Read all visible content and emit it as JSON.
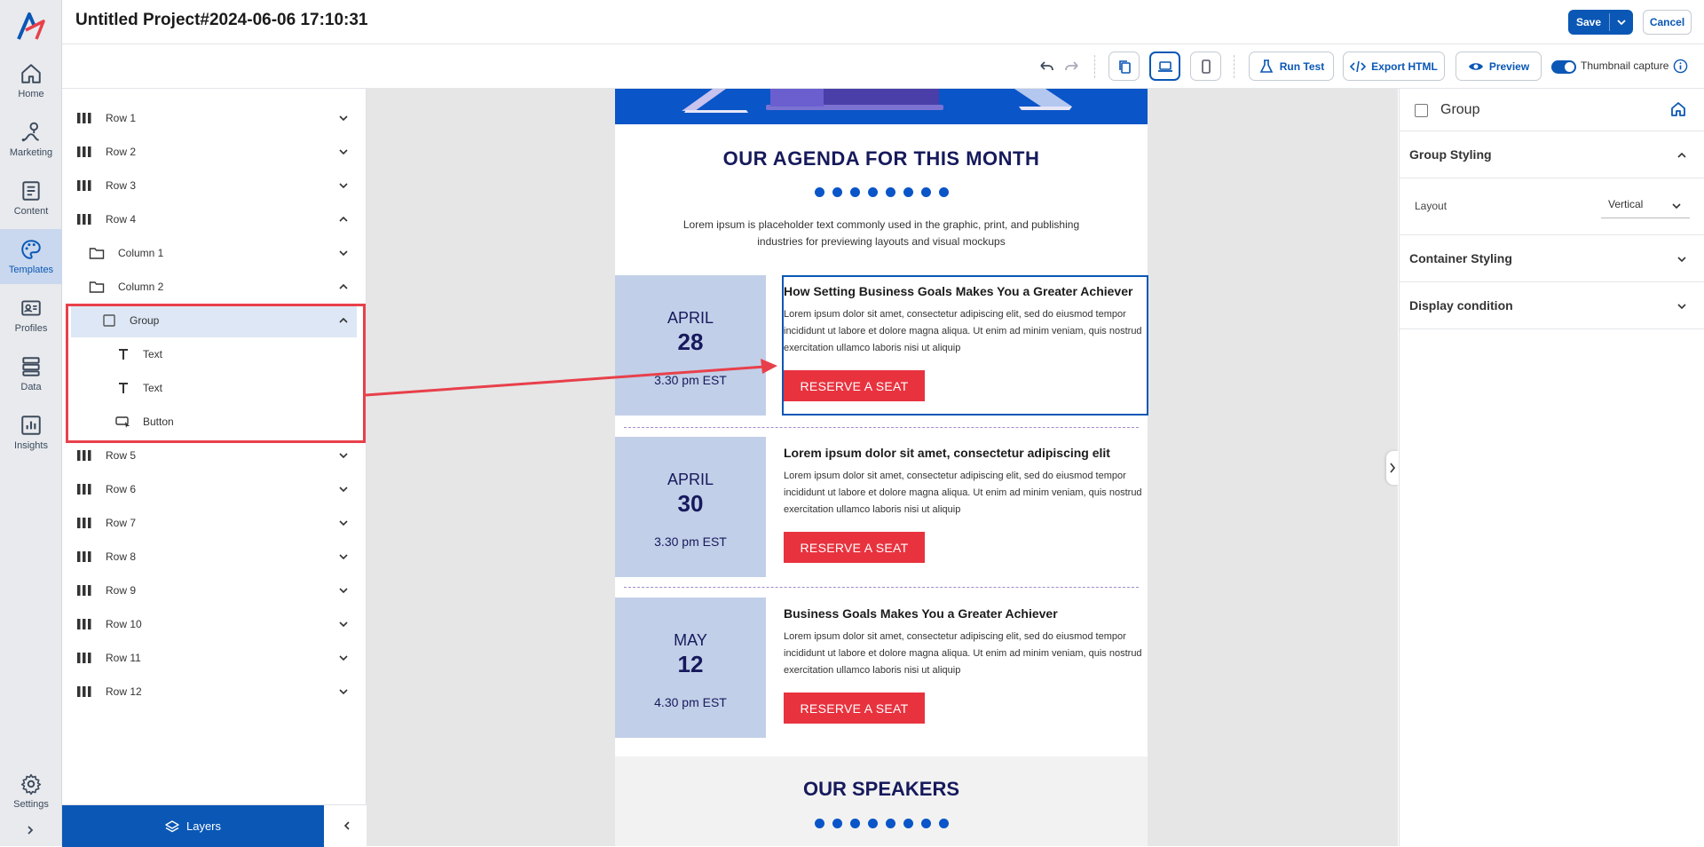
{
  "app": {
    "project_title": "Untitled Project#2024-06-06 17:10:31",
    "save_label": "Save",
    "cancel_label": "Cancel"
  },
  "nav": {
    "items": [
      {
        "label": "Home",
        "icon": "home-icon"
      },
      {
        "label": "Marketing",
        "icon": "marketing-icon"
      },
      {
        "label": "Content",
        "icon": "content-icon"
      },
      {
        "label": "Templates",
        "icon": "palette-icon",
        "active": true
      },
      {
        "label": "Profiles",
        "icon": "profiles-icon"
      },
      {
        "label": "Data",
        "icon": "database-icon"
      },
      {
        "label": "Insights",
        "icon": "chart-icon"
      }
    ],
    "settings_label": "Settings"
  },
  "toolbar": {
    "run_test": "Run Test",
    "export_html": "Export HTML",
    "preview": "Preview",
    "thumbnail_capture": "Thumbnail capture",
    "thumbnail_enabled": true,
    "active_device": "desktop"
  },
  "layers": {
    "items": [
      {
        "label": "Row 1",
        "type": "row",
        "expanded": false
      },
      {
        "label": "Row 2",
        "type": "row",
        "expanded": false
      },
      {
        "label": "Row 3",
        "type": "row",
        "expanded": false
      },
      {
        "label": "Row 4",
        "type": "row",
        "expanded": true
      },
      {
        "label": "Column 1",
        "type": "column",
        "expanded": false
      },
      {
        "label": "Column 2",
        "type": "column",
        "expanded": true
      },
      {
        "label": "Group",
        "type": "group",
        "expanded": true,
        "selected": true
      },
      {
        "label": "Text",
        "type": "text"
      },
      {
        "label": "Text",
        "type": "text"
      },
      {
        "label": "Button",
        "type": "button"
      },
      {
        "label": "Row 5",
        "type": "row",
        "expanded": false
      },
      {
        "label": "Row 6",
        "type": "row",
        "expanded": false
      },
      {
        "label": "Row 7",
        "type": "row",
        "expanded": false
      },
      {
        "label": "Row 8",
        "type": "row",
        "expanded": false
      },
      {
        "label": "Row 9",
        "type": "row",
        "expanded": false
      },
      {
        "label": "Row 10",
        "type": "row",
        "expanded": false
      },
      {
        "label": "Row 11",
        "type": "row",
        "expanded": false
      },
      {
        "label": "Row 12",
        "type": "row",
        "expanded": false
      }
    ],
    "footer_tab": "Layers"
  },
  "email": {
    "agenda_title": "OUR AGENDA FOR THIS MONTH",
    "agenda_sub": "Lorem ipsum is placeholder text commonly used in the graphic, print, and publishing industries for previewing layouts and visual mockups",
    "events": [
      {
        "month": "APRIL",
        "day": "28",
        "time": "3.30 pm EST",
        "heading": "How Setting Business Goals Makes You a Greater Achiever",
        "body": "Lorem ipsum dolor sit amet, consectetur adipiscing elit, sed do eiusmod tempor incididunt ut labore et dolore magna aliqua. Ut enim ad minim veniam, quis nostrud exercitation ullamco laboris nisi ut aliquip",
        "button": "RESERVE A SEAT"
      },
      {
        "month": "APRIL",
        "day": "30",
        "time": "3.30 pm EST",
        "heading": "Lorem ipsum dolor sit amet, consectetur adipiscing elit",
        "body": "Lorem ipsum dolor sit amet, consectetur adipiscing elit, sed do eiusmod tempor incididunt ut labore et dolore magna aliqua. Ut enim ad minim veniam, quis nostrud exercitation ullamco laboris nisi ut aliquip",
        "button": "RESERVE A SEAT"
      },
      {
        "month": "MAY",
        "day": "12",
        "time": "4.30 pm EST",
        "heading": "Business Goals Makes You a Greater Achiever",
        "body": "Lorem ipsum dolor sit amet, consectetur adipiscing elit, sed do eiusmod tempor incididunt ut labore et dolore magna aliqua. Ut enim ad minim veniam, quis nostrud exercitation ullamco laboris nisi ut aliquip",
        "button": "RESERVE A SEAT"
      }
    ],
    "speakers_title": "OUR SPEAKERS"
  },
  "properties": {
    "title": "Group",
    "sections": [
      {
        "label": "Group Styling",
        "expanded": true
      },
      {
        "label": "Container Styling",
        "expanded": false
      },
      {
        "label": "Display condition",
        "expanded": false
      }
    ],
    "layout_label": "Layout",
    "layout_value": "Vertical"
  },
  "colors": {
    "brand": "#0a57b5",
    "accent_red": "#e8333f",
    "date_box": "#c2cfe8",
    "headline_navy": "#161a5c",
    "annotation_red": "#e8404b"
  }
}
